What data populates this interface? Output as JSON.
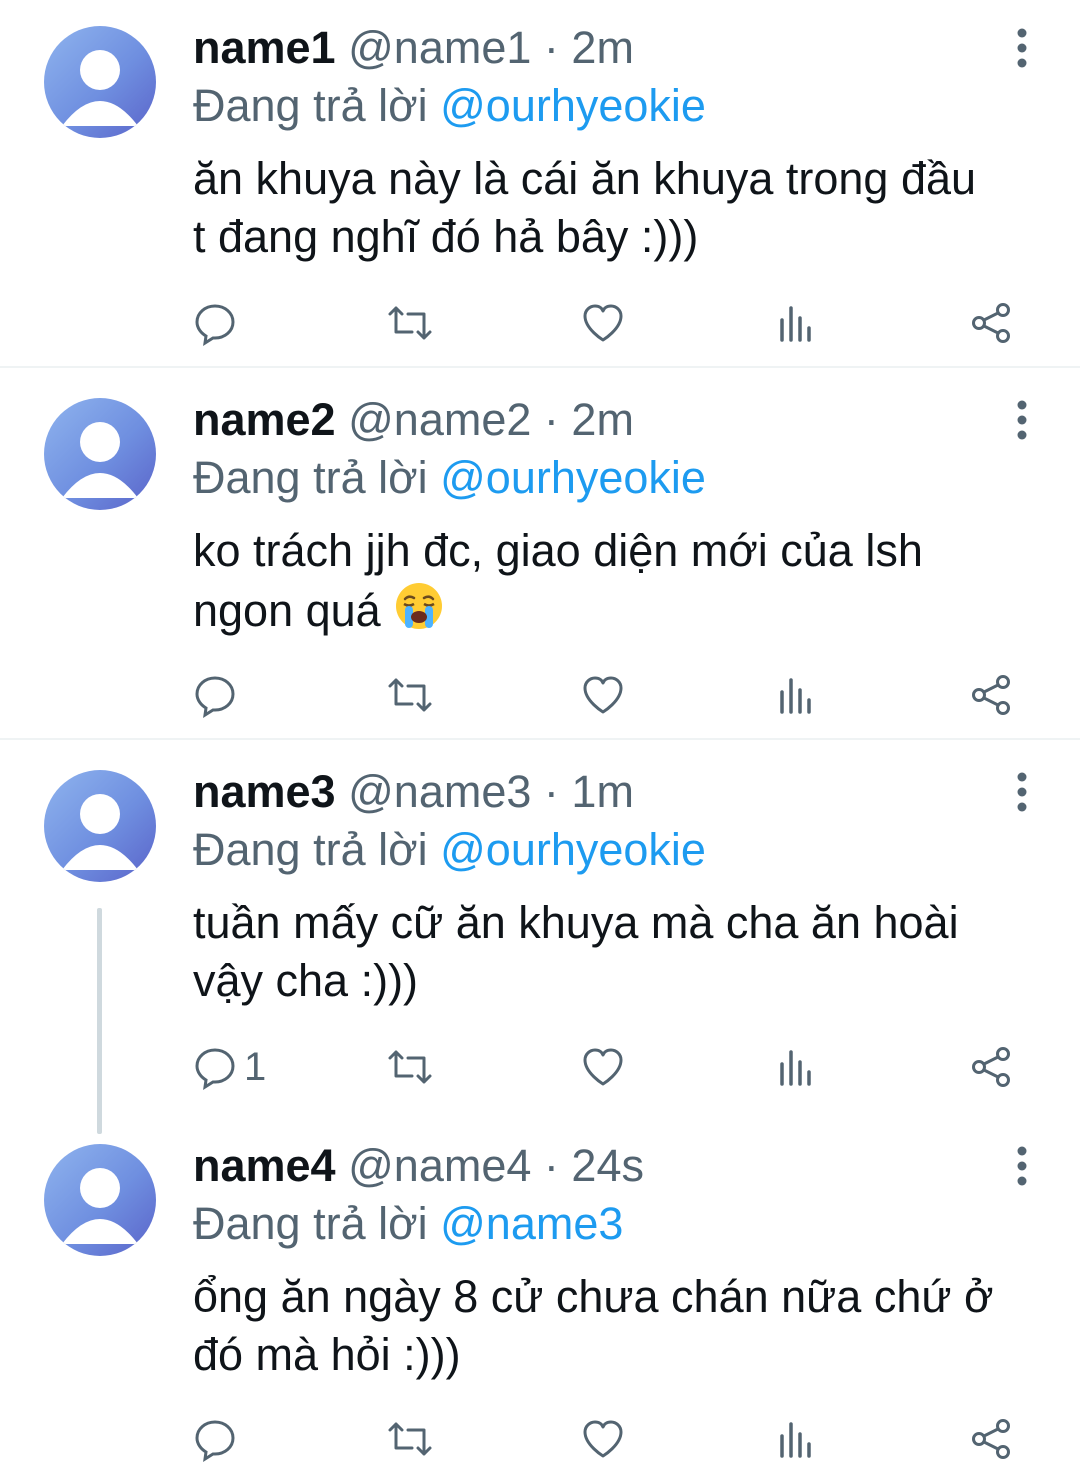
{
  "colors": {
    "accent": "#1d9bf0",
    "muted": "#536471",
    "text": "#0f1419"
  },
  "icons": {
    "reply": "speech-bubble-icon",
    "retweet": "retweet-icon",
    "like": "heart-icon",
    "views": "bar-chart-icon",
    "share": "share-icon",
    "more": "vertical-dots-icon",
    "crying": "loudly-crying-face-emoji"
  },
  "reply_prefix": "Đang trả lời",
  "tweets": [
    {
      "name": "name1",
      "handle": "@name1",
      "time": "2m",
      "reply_to": "@ourhyeokie",
      "text": "ăn khuya này là cái ăn khuya trong đầu\nt đang nghĩ đó hả bây :)))",
      "reply_count": ""
    },
    {
      "name": "name2",
      "handle": "@name2",
      "time": "2m",
      "reply_to": "@ourhyeokie",
      "text": "ko trách jjh đc, giao diện mới của lsh\nngon quá",
      "reply_count": ""
    },
    {
      "name": "name3",
      "handle": "@name3",
      "time": "1m",
      "reply_to": "@ourhyeokie",
      "text": "tuần mấy cữ ăn khuya mà cha ăn hoài\nvậy cha :)))",
      "reply_count": "1"
    },
    {
      "name": "name4",
      "handle": "@name4",
      "time": "24s",
      "reply_to": "@name3",
      "text": "ổng ăn ngày 8 cử chưa chán nữa chứ ở\nđó mà hỏi :)))",
      "reply_count": ""
    }
  ]
}
